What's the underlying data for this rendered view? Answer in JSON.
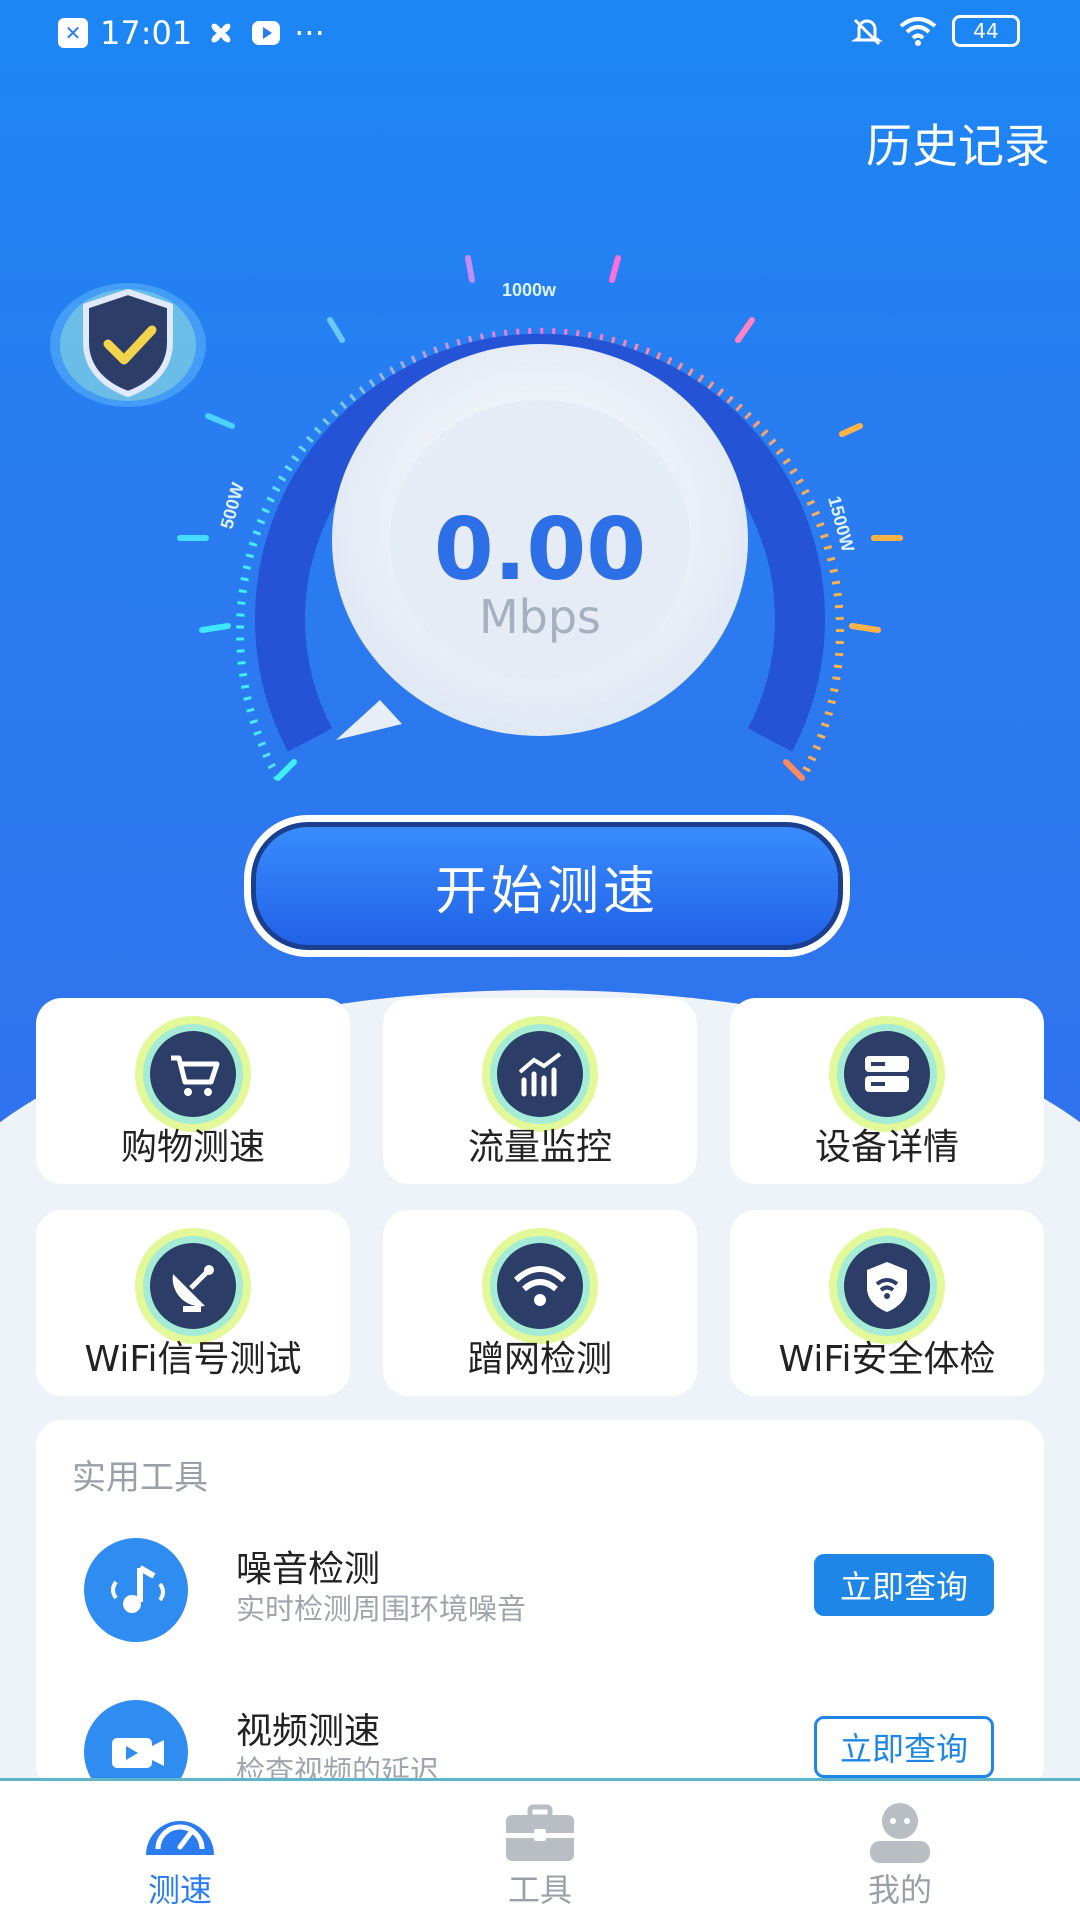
{
  "status_bar": {
    "time": "17:01",
    "battery": "44",
    "more": "···"
  },
  "header": {
    "history_label": "历史记录"
  },
  "speedometer": {
    "value": "0.00",
    "unit": "Mbps",
    "scale_labels": [
      "500W",
      "1000w",
      "1500W"
    ]
  },
  "start_button": {
    "label": "开始测速"
  },
  "features": [
    {
      "label": "购物测速",
      "icon": "shopping-cart-icon"
    },
    {
      "label": "流量监控",
      "icon": "chart-icon"
    },
    {
      "label": "设备详情",
      "icon": "device-icon"
    },
    {
      "label": "WiFi信号测试",
      "icon": "satellite-icon"
    },
    {
      "label": "蹭网检测",
      "icon": "wifi-icon"
    },
    {
      "label": "WiFi安全体检",
      "icon": "wifi-shield-icon"
    }
  ],
  "tools": {
    "title": "实用工具",
    "items": [
      {
        "name": "噪音检测",
        "desc": "实时检测周围环境噪音",
        "button": "立即查询",
        "icon": "music-note-icon"
      },
      {
        "name": "视频测速",
        "desc": "检查视频的延迟",
        "button": "立即查询",
        "icon": "video-camera-icon"
      }
    ]
  },
  "tabbar": [
    {
      "label": "测速",
      "active": true,
      "icon": "gauge-icon"
    },
    {
      "label": "工具",
      "active": false,
      "icon": "toolbox-icon"
    },
    {
      "label": "我的",
      "active": false,
      "icon": "user-icon"
    }
  ],
  "colors": {
    "primary": "#2a7cf0",
    "active_tab": "#2a7cf0",
    "inactive_tab": "#9aa0a8",
    "button": "#1d86e6"
  }
}
